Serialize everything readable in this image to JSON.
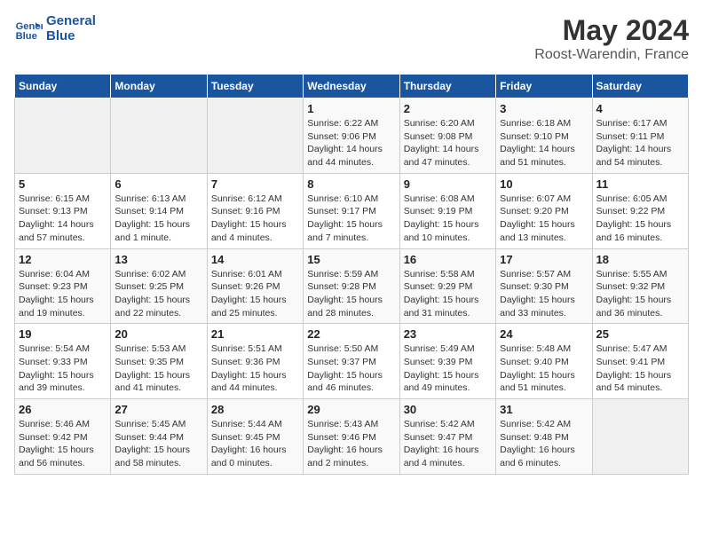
{
  "header": {
    "logo_general": "General",
    "logo_blue": "Blue",
    "title": "May 2024",
    "subtitle": "Roost-Warendin, France"
  },
  "weekdays": [
    "Sunday",
    "Monday",
    "Tuesday",
    "Wednesday",
    "Thursday",
    "Friday",
    "Saturday"
  ],
  "weeks": [
    [
      {
        "day": "",
        "sunrise": "",
        "sunset": "",
        "daylight": ""
      },
      {
        "day": "",
        "sunrise": "",
        "sunset": "",
        "daylight": ""
      },
      {
        "day": "",
        "sunrise": "",
        "sunset": "",
        "daylight": ""
      },
      {
        "day": "1",
        "sunrise": "Sunrise: 6:22 AM",
        "sunset": "Sunset: 9:06 PM",
        "daylight": "Daylight: 14 hours and 44 minutes."
      },
      {
        "day": "2",
        "sunrise": "Sunrise: 6:20 AM",
        "sunset": "Sunset: 9:08 PM",
        "daylight": "Daylight: 14 hours and 47 minutes."
      },
      {
        "day": "3",
        "sunrise": "Sunrise: 6:18 AM",
        "sunset": "Sunset: 9:10 PM",
        "daylight": "Daylight: 14 hours and 51 minutes."
      },
      {
        "day": "4",
        "sunrise": "Sunrise: 6:17 AM",
        "sunset": "Sunset: 9:11 PM",
        "daylight": "Daylight: 14 hours and 54 minutes."
      }
    ],
    [
      {
        "day": "5",
        "sunrise": "Sunrise: 6:15 AM",
        "sunset": "Sunset: 9:13 PM",
        "daylight": "Daylight: 14 hours and 57 minutes."
      },
      {
        "day": "6",
        "sunrise": "Sunrise: 6:13 AM",
        "sunset": "Sunset: 9:14 PM",
        "daylight": "Daylight: 15 hours and 1 minute."
      },
      {
        "day": "7",
        "sunrise": "Sunrise: 6:12 AM",
        "sunset": "Sunset: 9:16 PM",
        "daylight": "Daylight: 15 hours and 4 minutes."
      },
      {
        "day": "8",
        "sunrise": "Sunrise: 6:10 AM",
        "sunset": "Sunset: 9:17 PM",
        "daylight": "Daylight: 15 hours and 7 minutes."
      },
      {
        "day": "9",
        "sunrise": "Sunrise: 6:08 AM",
        "sunset": "Sunset: 9:19 PM",
        "daylight": "Daylight: 15 hours and 10 minutes."
      },
      {
        "day": "10",
        "sunrise": "Sunrise: 6:07 AM",
        "sunset": "Sunset: 9:20 PM",
        "daylight": "Daylight: 15 hours and 13 minutes."
      },
      {
        "day": "11",
        "sunrise": "Sunrise: 6:05 AM",
        "sunset": "Sunset: 9:22 PM",
        "daylight": "Daylight: 15 hours and 16 minutes."
      }
    ],
    [
      {
        "day": "12",
        "sunrise": "Sunrise: 6:04 AM",
        "sunset": "Sunset: 9:23 PM",
        "daylight": "Daylight: 15 hours and 19 minutes."
      },
      {
        "day": "13",
        "sunrise": "Sunrise: 6:02 AM",
        "sunset": "Sunset: 9:25 PM",
        "daylight": "Daylight: 15 hours and 22 minutes."
      },
      {
        "day": "14",
        "sunrise": "Sunrise: 6:01 AM",
        "sunset": "Sunset: 9:26 PM",
        "daylight": "Daylight: 15 hours and 25 minutes."
      },
      {
        "day": "15",
        "sunrise": "Sunrise: 5:59 AM",
        "sunset": "Sunset: 9:28 PM",
        "daylight": "Daylight: 15 hours and 28 minutes."
      },
      {
        "day": "16",
        "sunrise": "Sunrise: 5:58 AM",
        "sunset": "Sunset: 9:29 PM",
        "daylight": "Daylight: 15 hours and 31 minutes."
      },
      {
        "day": "17",
        "sunrise": "Sunrise: 5:57 AM",
        "sunset": "Sunset: 9:30 PM",
        "daylight": "Daylight: 15 hours and 33 minutes."
      },
      {
        "day": "18",
        "sunrise": "Sunrise: 5:55 AM",
        "sunset": "Sunset: 9:32 PM",
        "daylight": "Daylight: 15 hours and 36 minutes."
      }
    ],
    [
      {
        "day": "19",
        "sunrise": "Sunrise: 5:54 AM",
        "sunset": "Sunset: 9:33 PM",
        "daylight": "Daylight: 15 hours and 39 minutes."
      },
      {
        "day": "20",
        "sunrise": "Sunrise: 5:53 AM",
        "sunset": "Sunset: 9:35 PM",
        "daylight": "Daylight: 15 hours and 41 minutes."
      },
      {
        "day": "21",
        "sunrise": "Sunrise: 5:51 AM",
        "sunset": "Sunset: 9:36 PM",
        "daylight": "Daylight: 15 hours and 44 minutes."
      },
      {
        "day": "22",
        "sunrise": "Sunrise: 5:50 AM",
        "sunset": "Sunset: 9:37 PM",
        "daylight": "Daylight: 15 hours and 46 minutes."
      },
      {
        "day": "23",
        "sunrise": "Sunrise: 5:49 AM",
        "sunset": "Sunset: 9:39 PM",
        "daylight": "Daylight: 15 hours and 49 minutes."
      },
      {
        "day": "24",
        "sunrise": "Sunrise: 5:48 AM",
        "sunset": "Sunset: 9:40 PM",
        "daylight": "Daylight: 15 hours and 51 minutes."
      },
      {
        "day": "25",
        "sunrise": "Sunrise: 5:47 AM",
        "sunset": "Sunset: 9:41 PM",
        "daylight": "Daylight: 15 hours and 54 minutes."
      }
    ],
    [
      {
        "day": "26",
        "sunrise": "Sunrise: 5:46 AM",
        "sunset": "Sunset: 9:42 PM",
        "daylight": "Daylight: 15 hours and 56 minutes."
      },
      {
        "day": "27",
        "sunrise": "Sunrise: 5:45 AM",
        "sunset": "Sunset: 9:44 PM",
        "daylight": "Daylight: 15 hours and 58 minutes."
      },
      {
        "day": "28",
        "sunrise": "Sunrise: 5:44 AM",
        "sunset": "Sunset: 9:45 PM",
        "daylight": "Daylight: 16 hours and 0 minutes."
      },
      {
        "day": "29",
        "sunrise": "Sunrise: 5:43 AM",
        "sunset": "Sunset: 9:46 PM",
        "daylight": "Daylight: 16 hours and 2 minutes."
      },
      {
        "day": "30",
        "sunrise": "Sunrise: 5:42 AM",
        "sunset": "Sunset: 9:47 PM",
        "daylight": "Daylight: 16 hours and 4 minutes."
      },
      {
        "day": "31",
        "sunrise": "Sunrise: 5:42 AM",
        "sunset": "Sunset: 9:48 PM",
        "daylight": "Daylight: 16 hours and 6 minutes."
      },
      {
        "day": "",
        "sunrise": "",
        "sunset": "",
        "daylight": ""
      }
    ]
  ]
}
